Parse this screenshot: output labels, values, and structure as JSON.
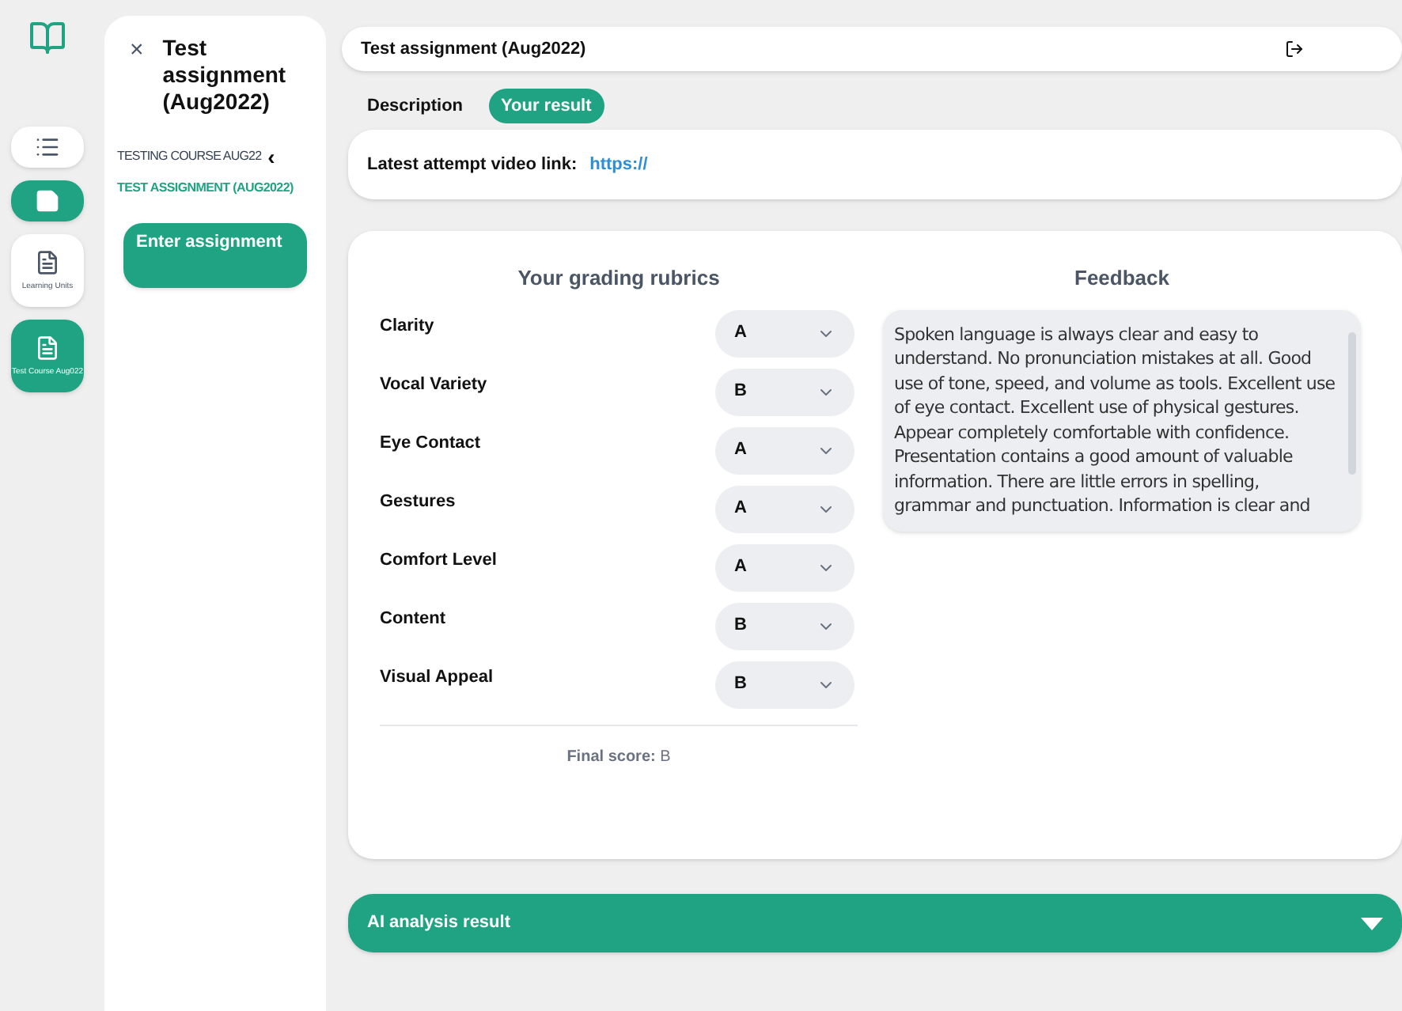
{
  "rail": [
    {
      "kind": "list",
      "active": false
    },
    {
      "kind": "note",
      "active": true
    },
    {
      "kind": "document",
      "label": "Learning Units",
      "active": false
    },
    {
      "kind": "document",
      "label": "Test Course Aug022",
      "active": true
    }
  ],
  "panel": {
    "close": "×",
    "title": "Test assignment (Aug2022)",
    "course": "TESTING COURSE AUG22",
    "back": "‹",
    "assignment": "TEST ASSIGNMENT (AUG2022)",
    "button": "Enter assignment"
  },
  "header": {
    "title": "Test  assignment (Aug2022)"
  },
  "tabs": [
    {
      "label": "Description",
      "selected": false
    },
    {
      "label": "Your result",
      "selected": true
    }
  ],
  "video": {
    "label": "Latest attempt video link:",
    "link": "https://"
  },
  "rubrics": {
    "title": "Your grading rubrics",
    "items": [
      {
        "name": "Clarity",
        "grade": "A"
      },
      {
        "name": "Vocal Variety",
        "grade": "B"
      },
      {
        "name": "Eye Contact",
        "grade": "A"
      },
      {
        "name": "Gestures",
        "grade": "A"
      },
      {
        "name": "Comfort Level",
        "grade": "A"
      },
      {
        "name": "Content",
        "grade": "B"
      },
      {
        "name": "Visual Appeal",
        "grade": "B"
      }
    ],
    "final_label": "Final score:",
    "final_value": "B"
  },
  "feedback": {
    "title": "Feedback",
    "text": "Spoken language is always clear and easy to understand. No pronunciation mistakes at all. Good use of tone, speed, and volume as tools. Excellent use of eye contact. Excellent use of physical gestures. Appear completely comfortable with confidence. Presentation contains a good amount of valuable information. There are little errors in spelling, grammar and punctuation. Information is clear and"
  },
  "ai": {
    "title": "AI analysis result",
    "expanded": false
  }
}
